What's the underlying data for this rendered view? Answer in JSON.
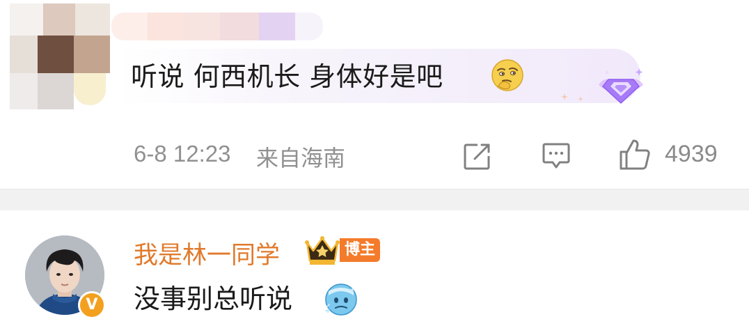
{
  "comment1": {
    "text": "听说 何西机长 身体好是吧",
    "emoji": "thinking-emoji",
    "badge": "purple-gem-badge",
    "time": "6-8 12:23",
    "location": "来自海南",
    "share_icon": "share-icon",
    "reply_icon": "comment-icon",
    "like_icon": "thumbs-up-icon",
    "like_count": "4939"
  },
  "comment2": {
    "username": "我是林一同学",
    "crown_icon": "crown-icon",
    "author_tag": "博主",
    "verified_mark": "V",
    "text": "没事别总听说",
    "emoji": "cold-face-emoji"
  },
  "colors": {
    "username": "#e07a2c",
    "author_tag_bg": "#f47b2b",
    "meta_text": "#909090",
    "verified_badge": "#f3a01f",
    "divider": "#f1f1f1"
  }
}
